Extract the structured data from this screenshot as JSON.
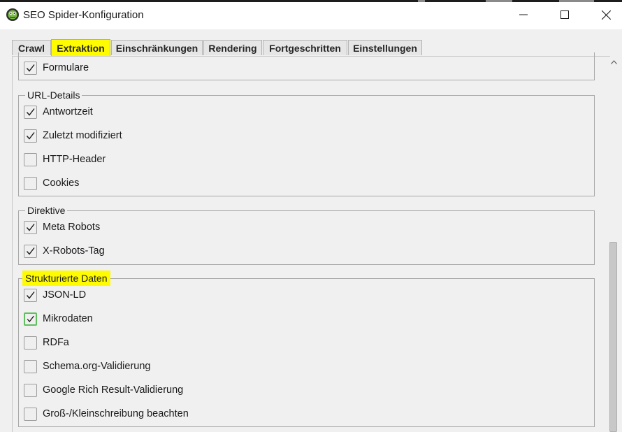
{
  "window": {
    "title": "SEO Spider-Konfiguration",
    "icon": "spider-frog-icon",
    "controls": [
      "minimize-icon",
      "maximize-icon",
      "close-icon"
    ]
  },
  "tabs": [
    {
      "label": "Crawl",
      "active": false
    },
    {
      "label": "Extraktion",
      "active": true
    },
    {
      "label": "Einschränkungen",
      "active": false
    },
    {
      "label": "Rendering",
      "active": false
    },
    {
      "label": "Fortgeschritten",
      "active": false
    },
    {
      "label": "Einstellungen",
      "active": false
    }
  ],
  "groups": {
    "top": {
      "items": [
        {
          "label": "Formulare",
          "checked": true
        }
      ]
    },
    "url_details": {
      "title": "URL-Details",
      "items": [
        {
          "label": "Antwortzeit",
          "checked": true
        },
        {
          "label": "Zuletzt modifiziert",
          "checked": true
        },
        {
          "label": "HTTP-Header",
          "checked": false
        },
        {
          "label": "Cookies",
          "checked": false
        }
      ]
    },
    "direktive": {
      "title": "Direktive",
      "items": [
        {
          "label": "Meta Robots",
          "checked": true
        },
        {
          "label": "X-Robots-Tag",
          "checked": true
        }
      ]
    },
    "strukturierte_daten": {
      "title": "Strukturierte Daten",
      "highlighted": true,
      "items": [
        {
          "label": "JSON-LD",
          "checked": true
        },
        {
          "label": "Mikrodaten",
          "checked": true,
          "focused": true
        },
        {
          "label": "RDFa",
          "checked": false
        },
        {
          "label": "Schema.org-Validierung",
          "checked": false
        },
        {
          "label": "Google Rich Result-Validierung",
          "checked": false
        },
        {
          "label": "Groß-/Kleinschreibung beachten",
          "checked": false
        }
      ]
    }
  },
  "colors": {
    "highlight": "#fffb00",
    "focus_border": "#5ec05e"
  }
}
